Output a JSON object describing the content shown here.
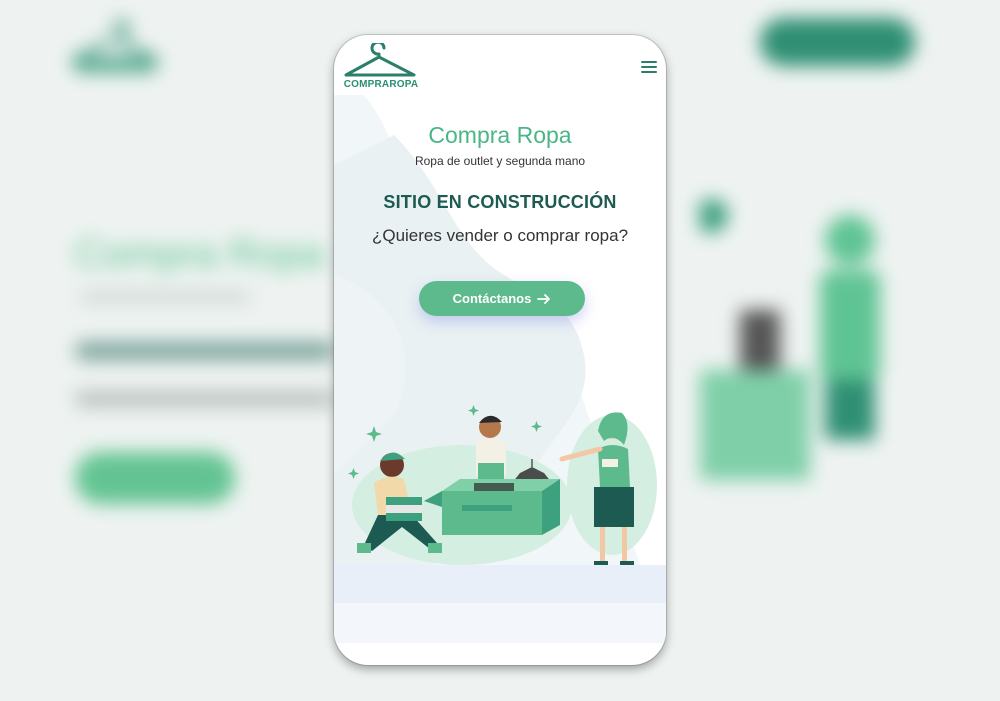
{
  "brand": {
    "logo_text": "COMPRAROPA",
    "primary_color": "#5dba8d",
    "dark_color": "#1d5b52"
  },
  "header": {
    "menu_icon": "hamburger-icon"
  },
  "hero": {
    "title": "Compra Ropa",
    "subtitle": "Ropa de outlet y segunda mano",
    "heading": "SITIO EN CONSTRUCCIÓN",
    "question": "¿Quieres vender o comprar ropa?",
    "cta_label": "Contáctanos",
    "cta_icon": "arrow-right-icon"
  },
  "illustration": {
    "icon": "people-sorting-clothes-illustration"
  }
}
